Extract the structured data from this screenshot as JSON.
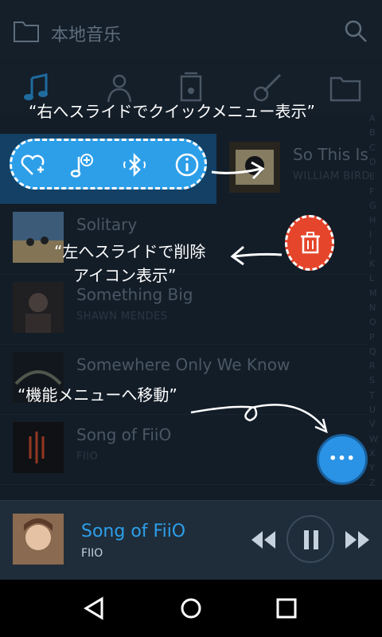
{
  "header": {
    "title": "本地音乐",
    "folder_icon": "folder-icon",
    "search_icon": "search-icon"
  },
  "tabs": [
    {
      "icon": "music-note-icon",
      "active": true
    },
    {
      "icon": "artist-icon",
      "active": false
    },
    {
      "icon": "album-icon",
      "active": false
    },
    {
      "icon": "guitar-icon",
      "active": false
    },
    {
      "icon": "folder-icon",
      "active": false
    }
  ],
  "rows": [
    {
      "song": "So This Is",
      "artist": "WILLIAM BIRD"
    },
    {
      "song": "Solitary",
      "artist": ""
    },
    {
      "song": "Something Big",
      "artist": "SHAWN MENDES"
    },
    {
      "song": "Somewhere Only We Know",
      "artist": ""
    },
    {
      "song": "Song of FiiO",
      "artist": "FIIO"
    }
  ],
  "index_letters": [
    "A",
    "B",
    "C",
    "D",
    "E",
    "F",
    "G",
    "H",
    "I",
    "J",
    "K",
    "L",
    "M",
    "N",
    "O",
    "P",
    "Q",
    "R",
    "S",
    "T",
    "U",
    "V",
    "W",
    "X",
    "Y",
    "Z"
  ],
  "quick_menu_icons": [
    "heart-add-icon",
    "playlist-add-icon",
    "bluetooth-icon",
    "info-icon"
  ],
  "captions": {
    "right_slide": "“右へスライドでクイックメニュー表示”",
    "left_slide_1": "“左へスライドで削除",
    "left_slide_2": "アイコン表示”",
    "function_menu": "“機能メニューへ移動”"
  },
  "fab_label": "•••",
  "player": {
    "song": "Song of FiiO",
    "artist": "FIIO"
  },
  "colors": {
    "accent": "#2d9fe9",
    "delete": "#e5452a"
  }
}
